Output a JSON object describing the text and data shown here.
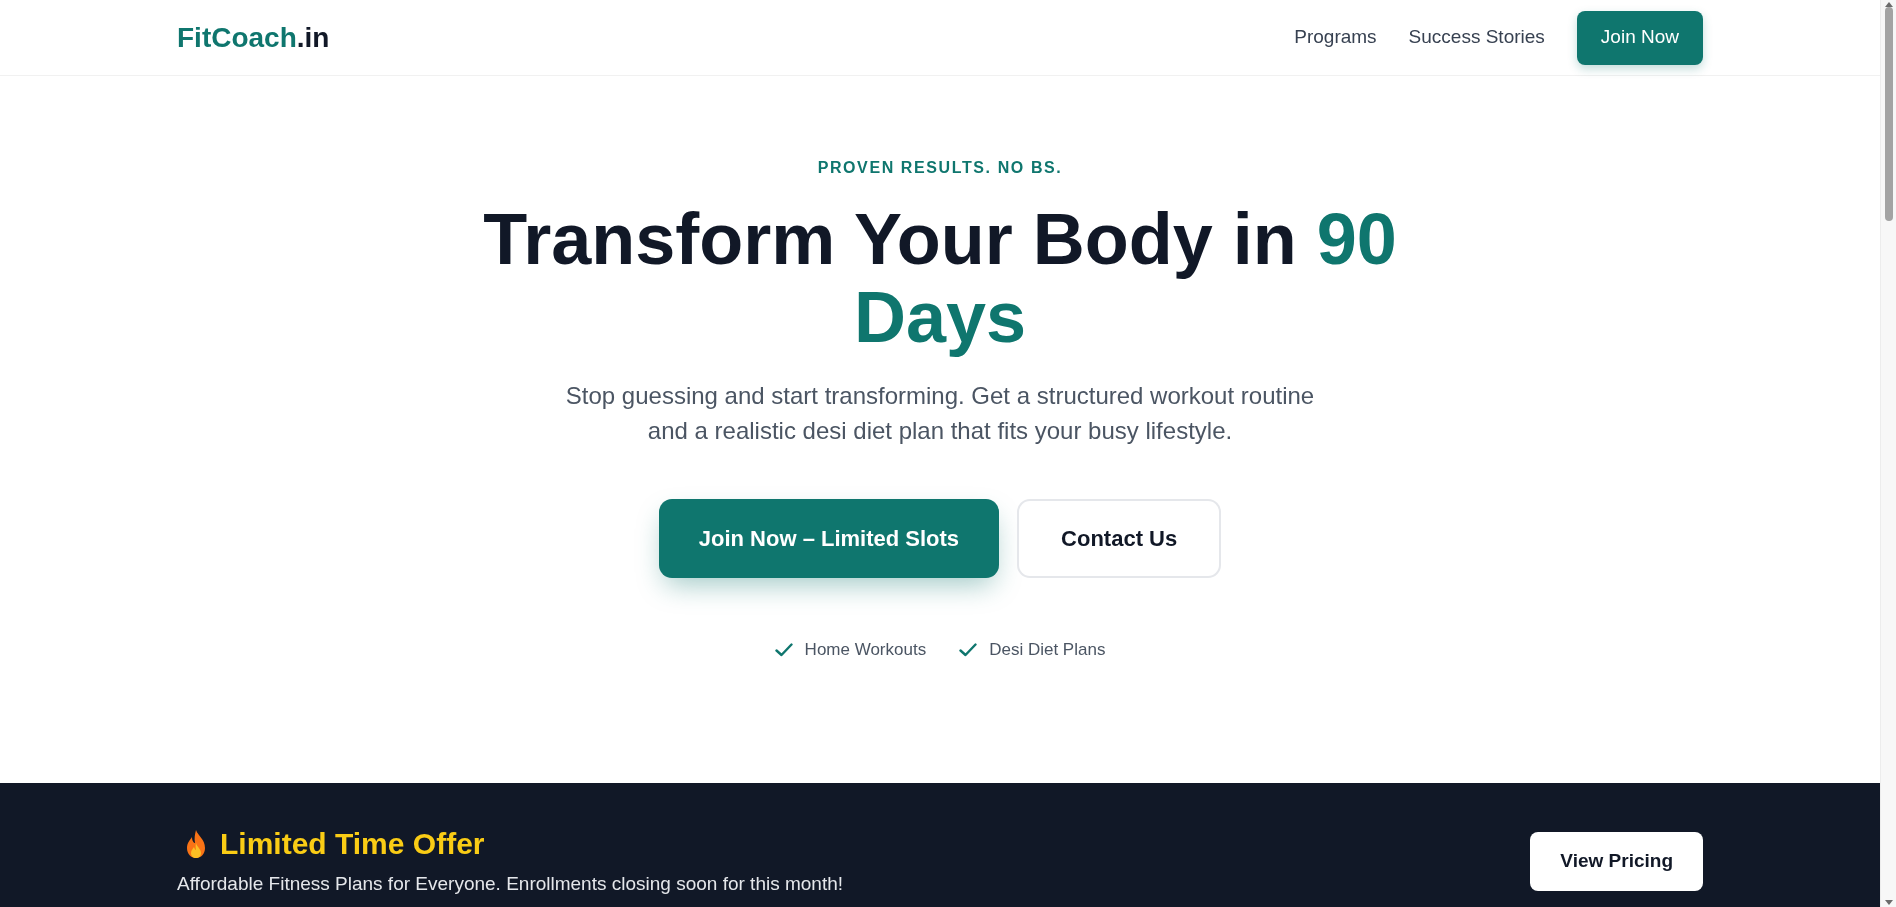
{
  "header": {
    "logo": {
      "name": "FitCoach",
      "suffix": ".in"
    },
    "nav": [
      {
        "label": "Programs",
        "kind": "link"
      },
      {
        "label": "Success Stories",
        "kind": "link"
      },
      {
        "label": "Join Now",
        "kind": "button"
      }
    ]
  },
  "hero": {
    "eyebrow": "PROVEN RESULTS. NO BS.",
    "headline": {
      "text": "Transform Your Body in",
      "highlight": "90 Days"
    },
    "subtitle": "Stop guessing and start transforming. Get a structured workout routine and a realistic desi diet plan that fits your busy lifestyle.",
    "buttons": [
      {
        "label": "Join Now – Limited Slots",
        "kind": "primary"
      },
      {
        "label": "Contact Us",
        "kind": "secondary"
      }
    ],
    "features": [
      "Home Workouts",
      "Desi Diet Plans"
    ]
  },
  "offer_banner": {
    "title": "Limited Time Offer",
    "text": "Affordable Fitness Plans for Everyone. Enrollments closing soon for this month!",
    "button": "View Pricing"
  }
}
